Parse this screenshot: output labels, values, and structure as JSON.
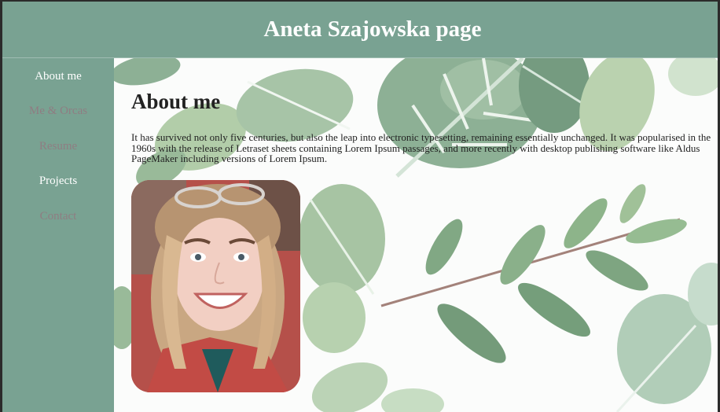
{
  "header": {
    "title": "Aneta Szajowska page"
  },
  "nav": {
    "items": [
      {
        "label": "About me",
        "state": "active"
      },
      {
        "label": "Me & Orcas",
        "state": "muted"
      },
      {
        "label": "Resume",
        "state": "muted"
      },
      {
        "label": "Projects",
        "state": "active"
      },
      {
        "label": "Contact",
        "state": "muted"
      }
    ]
  },
  "main": {
    "title": "About me",
    "text": "It has survived not only five centuries, but also the leap into electronic typesetting, remaining essentially unchanged. It was popularised in the 1960s with the release of Letraset sheets containing Lorem Ipsum passages, and more recently with desktop publishing software like Aldus PageMaker including versions of Lorem Ipsum."
  },
  "colors": {
    "accent": "#79a292",
    "nav_active": "#ffffff",
    "nav_muted": "#8f7d82"
  }
}
